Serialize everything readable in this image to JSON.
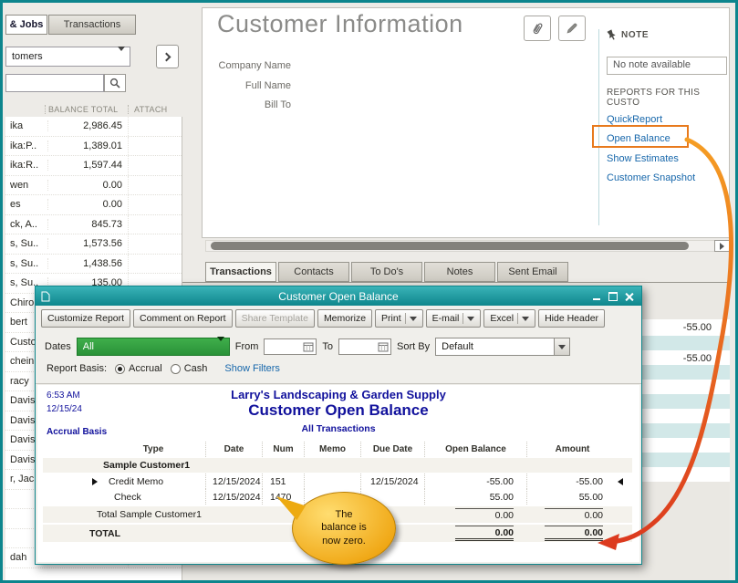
{
  "colors": {
    "frame_teal": "#0d858d",
    "titlebar_teal": "#17979e",
    "link_blue": "#1767ab",
    "highlight_orange": "#e87a1d",
    "report_navy": "#11119c",
    "dropdown_green": "#2f9e3e",
    "callout_yellow": "#f2a913",
    "arrow_gradient_start": "#f59d23",
    "arrow_gradient_end": "#dc3a1e",
    "row_stripe_teal": "#d2e8e8"
  },
  "bg": {
    "tab_jobs": "& Jobs",
    "tab_transactions": "Transactions",
    "customers_dropdown": "tomers",
    "col_balance": "BALANCE TOTAL",
    "col_attach": "ATTACH",
    "customers": [
      {
        "name": "ika",
        "balance": "2,986.45"
      },
      {
        "name": "ika:P..",
        "balance": "1,389.01"
      },
      {
        "name": "ika:R..",
        "balance": "1,597.44"
      },
      {
        "name": "wen",
        "balance": "0.00"
      },
      {
        "name": "es",
        "balance": "0.00"
      },
      {
        "name": "ck, A..",
        "balance": "845.73"
      },
      {
        "name": "s, Su..",
        "balance": "1,573.56"
      },
      {
        "name": "s, Su..",
        "balance": "1,438.56"
      },
      {
        "name": "s, Su..",
        "balance": "135.00"
      }
    ],
    "more_customers": [
      "Chiro..",
      "bert",
      "Custo..",
      "chein..",
      "racy",
      "Davis,",
      "Davis,",
      "Davis,",
      "Davis,",
      "r, Jac.",
      "",
      "",
      "",
      "dah"
    ],
    "info_title": "Customer Information",
    "label_company": "Company Name",
    "label_fullname": "Full Name",
    "label_billto": "Bill To",
    "note_label": "NOTE",
    "note_value": "No note available",
    "reports_header": "REPORTS FOR THIS CUSTO",
    "link_quickreport": "QuickReport",
    "link_openbalance": "Open Balance",
    "link_estimates": "Show Estimates",
    "link_snapshot": "Customer Snapshot",
    "tabs": [
      "Transactions",
      "Contacts",
      "To Do's",
      "Notes",
      "Sent Email"
    ],
    "bg_values": [
      "-55.00",
      "-55.00"
    ]
  },
  "report": {
    "titlebar": "Customer Open Balance",
    "btn_customize": "Customize Report",
    "btn_comment": "Comment on Report",
    "btn_share": "Share Template",
    "btn_memorize": "Memorize",
    "btn_print": "Print",
    "btn_email": "E-mail",
    "btn_excel": "Excel",
    "btn_hideheader": "Hide Header",
    "lbl_dates": "Dates",
    "dates_value": "All",
    "lbl_from": "From",
    "lbl_to": "To",
    "lbl_sortby": "Sort By",
    "sortby_value": "Default",
    "lbl_basis": "Report Basis:",
    "radio_accrual": "Accrual",
    "radio_cash": "Cash",
    "link_showfilters": "Show Filters",
    "hdr_time": "6:53 AM",
    "hdr_date": "12/15/24",
    "hdr_basis": "Accrual Basis",
    "company": "Larry's Landscaping & Garden Supply",
    "report_title": "Customer Open Balance",
    "report_range": "All Transactions",
    "cols": [
      "Type",
      "Date",
      "Num",
      "Memo",
      "Due Date",
      "Open Balance",
      "Amount"
    ],
    "group": "Sample Customer1",
    "rows": [
      {
        "type": "Credit Memo",
        "date": "12/15/2024",
        "num": "151",
        "memo": "",
        "due": "12/15/2024",
        "open": "-55.00",
        "amount": "-55.00"
      },
      {
        "type": "Check",
        "date": "12/15/2024",
        "num": "1470",
        "memo": "",
        "due": "",
        "open": "55.00",
        "amount": "55.00"
      }
    ],
    "total_group_label": "Total Sample Customer1",
    "total_group_open": "0.00",
    "total_group_amount": "0.00",
    "total_label": "TOTAL",
    "total_open": "0.00",
    "total_amount": "0.00"
  },
  "callout": {
    "line1": "The",
    "line2": "balance  is",
    "line3": "now zero."
  }
}
